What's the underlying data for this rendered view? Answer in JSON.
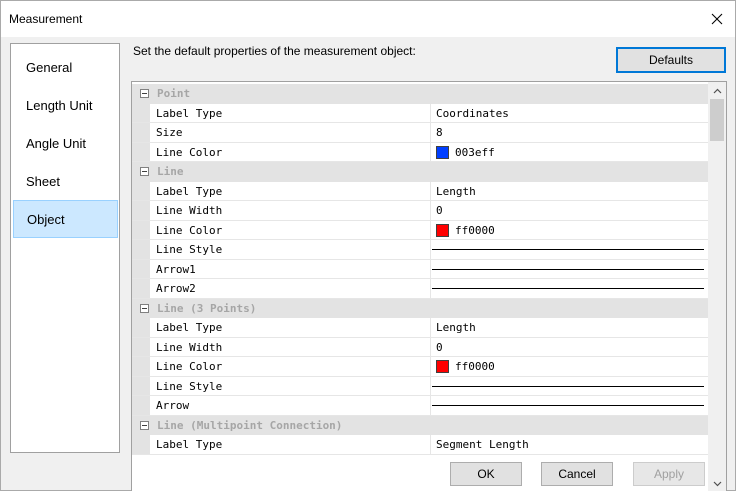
{
  "window": {
    "title": "Measurement"
  },
  "nav": {
    "items": [
      {
        "label": "General",
        "active": false
      },
      {
        "label": "Length Unit",
        "active": false
      },
      {
        "label": "Angle Unit",
        "active": false
      },
      {
        "label": "Sheet",
        "active": false
      },
      {
        "label": "Object",
        "active": true
      }
    ]
  },
  "content": {
    "description": "Set the default properties of the measurement object:",
    "defaults_label": "Defaults"
  },
  "grid": {
    "sections": [
      {
        "category": "Point",
        "props": [
          {
            "name": "Label Type",
            "value": "Coordinates",
            "kind": "text"
          },
          {
            "name": "Size",
            "value": "8",
            "kind": "text"
          },
          {
            "name": "Line Color",
            "value": "003eff",
            "kind": "color",
            "color": "#003eff"
          }
        ]
      },
      {
        "category": "Line",
        "props": [
          {
            "name": "Label Type",
            "value": "Length",
            "kind": "text"
          },
          {
            "name": "Line Width",
            "value": "0",
            "kind": "text"
          },
          {
            "name": "Line Color",
            "value": "ff0000",
            "kind": "color",
            "color": "#ff0000"
          },
          {
            "name": "Line Style",
            "value": "",
            "kind": "line"
          },
          {
            "name": "Arrow1",
            "value": "",
            "kind": "line"
          },
          {
            "name": "Arrow2",
            "value": "",
            "kind": "line"
          }
        ]
      },
      {
        "category": "Line (3 Points)",
        "props": [
          {
            "name": "Label Type",
            "value": "Length",
            "kind": "text"
          },
          {
            "name": "Line Width",
            "value": "0",
            "kind": "text"
          },
          {
            "name": "Line Color",
            "value": "ff0000",
            "kind": "color",
            "color": "#ff0000"
          },
          {
            "name": "Line Style",
            "value": "",
            "kind": "line"
          },
          {
            "name": "Arrow",
            "value": "",
            "kind": "line"
          }
        ]
      },
      {
        "category": "Line (Multipoint Connection)",
        "props": [
          {
            "name": "Label Type",
            "value": "Segment Length",
            "kind": "text"
          }
        ]
      }
    ]
  },
  "footer": {
    "ok_label": "OK",
    "cancel_label": "Cancel",
    "apply_label": "Apply"
  }
}
